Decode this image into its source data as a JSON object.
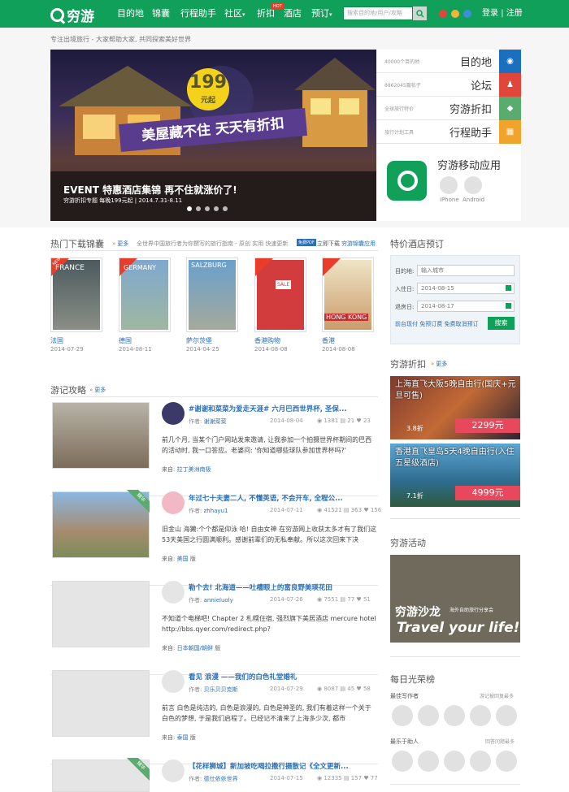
{
  "header": {
    "logo": "穷游",
    "nav": [
      "目的地",
      "锦囊",
      "行程助手",
      "社区",
      "折扣",
      "酒店",
      "预订"
    ],
    "hot": "HOT",
    "search_placeholder": "搜索目的地/用户/攻略",
    "login": "登录",
    "register": "注册",
    "sep": "|"
  },
  "tagline": "专注出境旅行 - 大家帮助大家, 共同探索美好世界",
  "hero": {
    "price": "199",
    "price_unit": "元起",
    "slogan": "美屋藏不住 天天有折扣",
    "event_title": "EVENT 特惠酒店集锦 再不住就涨价了!",
    "event_sub": "穷游折扣专题 每晚199元起 | 2014.7.31-8.11"
  },
  "sidebar": {
    "rows": [
      {
        "small": "40000个目的地",
        "big": "目的地",
        "color": "#1a6fbf",
        "icon": "pin-icon"
      },
      {
        "small": "8862045篇帖子",
        "big": "论坛",
        "color": "#e0463a",
        "icon": "people-icon"
      },
      {
        "small": "全球旅行特价",
        "big": "穷游折扣",
        "color": "#5aac6e",
        "icon": "tag-icon"
      },
      {
        "small": "旅行计划工具",
        "big": "行程助手",
        "color": "#f2a32b",
        "icon": "calendar-icon"
      }
    ],
    "app_title": "穷游移动应用",
    "iphone": "iPhone",
    "android": "Android"
  },
  "guides": {
    "title": "热门下载锦囊",
    "more": "更多",
    "desc": "全世界中国旅行者为你撰写的旅行指南 - 原创 实用 快速更新",
    "pdf": "免费PDF",
    "pdf_txt": "立即下载",
    "app_txt": "穷游锦囊应用",
    "new": "NEW",
    "items": [
      {
        "name": "法国",
        "date": "2014-07-29",
        "cover": "FRANCE"
      },
      {
        "name": "德国",
        "date": "2014-08-11",
        "cover": "GERMANY"
      },
      {
        "name": "萨尔茨堡",
        "date": "2014-04-25",
        "cover": "SALZBURG"
      },
      {
        "name": "香港购物",
        "date": "2014-08-08",
        "cover": "SALE"
      },
      {
        "name": "香港",
        "date": "2014-08-08",
        "cover": "HONG KONG"
      }
    ]
  },
  "travelogue": {
    "title": "游记攻略",
    "more": "更多",
    "author_lbl": "作者:",
    "from_lbl": "来自:",
    "posts": [
      {
        "title": "#谢谢和菜菜为爱走天涯# 六月巴西世界杯, 圣保...",
        "author": "谢谢菜菜",
        "date": "2014-08-04",
        "views": "1381",
        "comments": "21",
        "likes": "23",
        "body": "前几个月, 当某个门户网站发来邀请, 让我参加一个拍摄世界杯期间的巴西的活动时, 我一口答应。老婆问: '你知道哪些球队参加世界杯吗?'",
        "from": "拉丁美洲南极",
        "from2": ""
      },
      {
        "title": "年过七十夫妻二人, 不懂英语, 不会开车, 全程公...",
        "author": "zhhayu1",
        "date": "2014-07-11",
        "views": "41521",
        "comments": "363",
        "likes": "156",
        "body": "旧金山 海獭:个个都是仰泳 哈! 自由女神  在穷游网上收获太多才有了我们这53天美国之行圆满顺利。感谢前辈们的无私奉献。所以这次回来下决",
        "from": "美国",
        "from2": "版",
        "ribbon": "精华"
      },
      {
        "title": "勒个去! 北海道——吐槽眼上的富良野美瑛花田",
        "author": "annieluoly",
        "date": "2014-07-26",
        "views": "7551",
        "comments": "77",
        "likes": "51",
        "body": "不知道个电梯吧! Chapter 2 札幌住宿, 强烈旗下美居酒店 mercure hotel http://bbs.qyer.com/redirect.php?",
        "from": "日本朝国/朝鲜",
        "from2": "版"
      },
      {
        "title": "看见 浪漫 ——我们的白色礼堂婚礼",
        "author": "贝乐贝贝克斯",
        "date": "2014-07-29",
        "views": "8087",
        "comments": "45",
        "likes": "58",
        "body": "前言 白色是纯洁的, 白色是浪漫的, 白色是神圣的, 我们有着这样一个关于白色的梦想, 于是我们启程了。已经记不清来了上海多少次, 都市",
        "from": "泰国",
        "from2": "版"
      },
      {
        "title": "【花样狮城】新加坡吃喝拉撒行摄散记《全文更新...",
        "author": "德仕依依世界",
        "date": "2014-07-15",
        "views": "12335",
        "comments": "157",
        "likes": "77",
        "body": "",
        "from": "",
        "from2": "",
        "ribbon": "精华"
      }
    ]
  },
  "hotel": {
    "title": "特价酒店预订",
    "dest_lbl": "目的地:",
    "dest_ph": "输入城市",
    "in_lbl": "入住日:",
    "in_val": "2014-08-15",
    "out_lbl": "退房日:",
    "out_val": "2014-08-17",
    "links": "前台现付 免预订费 免费取消预订",
    "btn": "搜索"
  },
  "deals": {
    "title": "穷游折扣",
    "more": "更多",
    "items": [
      {
        "text": "上海直飞大阪5晚自由行(国庆+元旦可售)",
        "count": "3.8折",
        "price": "2299元"
      },
      {
        "text": "香港直飞皇岛5天4晚自由行(入住五星级酒店)",
        "count": "7.1折",
        "price": "4999元"
      }
    ]
  },
  "activity": {
    "title": "穷游活动",
    "banner1": "穷游沙龙",
    "banner2": "Travel your life!",
    "banner_sub": "海外自助旅行分享会"
  },
  "honor": {
    "title": "每日光荣榜",
    "best_writer": "最佳写作者",
    "writer_sub": "游记被回复最多",
    "best_helper": "最乐于助人",
    "helper_sub": "回答问题最多"
  }
}
